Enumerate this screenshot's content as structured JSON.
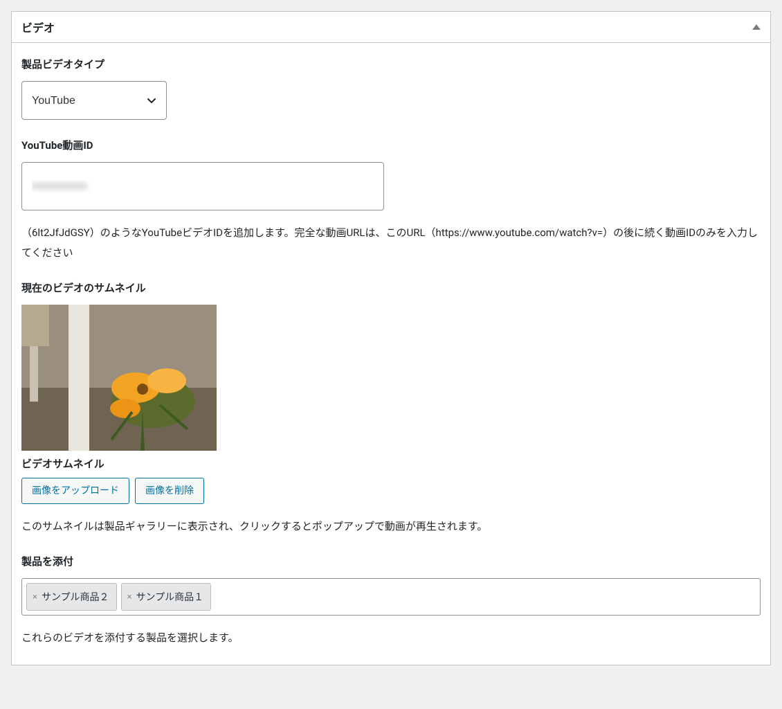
{
  "panel": {
    "title": "ビデオ"
  },
  "video_type": {
    "label": "製品ビデオタイプ",
    "value": "YouTube"
  },
  "youtube_id": {
    "label": "YouTube動画ID",
    "value": "xxxxxxxxxx",
    "help": "（6lt2JfJdGSY）のようなYouTubeビデオIDを追加します。完全な動画URLは、このURL（https://www.youtube.com/watch?v=）の後に続く動画IDのみを入力してください"
  },
  "thumbnail": {
    "current_label": "現在のビデオのサムネイル",
    "label": "ビデオサムネイル",
    "upload_btn": "画像をアップロード",
    "delete_btn": "画像を削除",
    "help": "このサムネイルは製品ギャラリーに表示され、クリックするとポップアップで動画が再生されます。"
  },
  "attach": {
    "label": "製品を添付",
    "tags": [
      "サンプル商品２",
      "サンプル商品１"
    ],
    "help": "これらのビデオを添付する製品を選択します。"
  }
}
